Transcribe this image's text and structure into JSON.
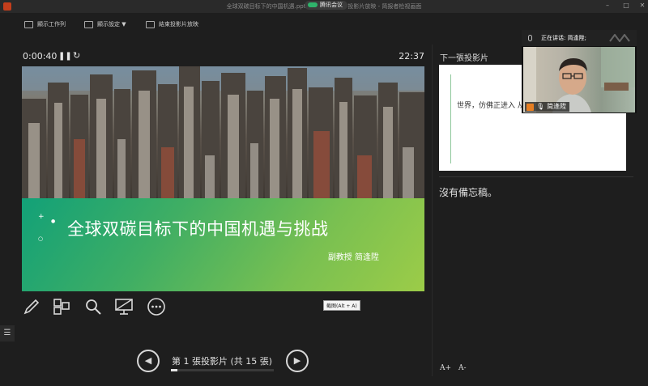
{
  "window": {
    "title": "全球双碳目标下的中国机遇.pptx - PowerPoint 投影片放映 - 简报者检视画面",
    "meeting_badge": "腾讯会议"
  },
  "toolbar": {
    "taskbar_label": "顯示工作列",
    "settings_label": "顯示設定 ▼",
    "end_show_label": "結束投影片放映"
  },
  "presenter": {
    "elapsed": "0:00:40",
    "clock": "22:37",
    "tooltip": "截图(Alt + A)",
    "slide_counter": "第 1 張投影片 (共 15 張)",
    "progress_fraction": 0.0667
  },
  "current_slide": {
    "title": "全球双碳目标下的中国机遇与挑战",
    "author": "副教授  简逢陞"
  },
  "next_slide": {
    "label": "下一張投影片",
    "text": "世界，仿佛正进入 从？"
  },
  "notes": {
    "text": "沒有備忘稿。"
  },
  "speaker": {
    "status": "正在讲话: 简逢陞;",
    "name": "简逢陞"
  },
  "icons": {
    "pen": "pen-icon",
    "slides": "see-all-slides-icon",
    "zoom": "zoom-icon",
    "screen": "black-screen-icon",
    "more": "more-options-icon",
    "prev": "previous-slide-icon",
    "next": "next-slide-icon",
    "font_up": "A+",
    "font_down": "A-"
  },
  "colors": {
    "band_start": "#12a178",
    "band_end": "#9ccc48",
    "ppt_red": "#c43e1c",
    "meeting_green": "#2fb36b"
  }
}
